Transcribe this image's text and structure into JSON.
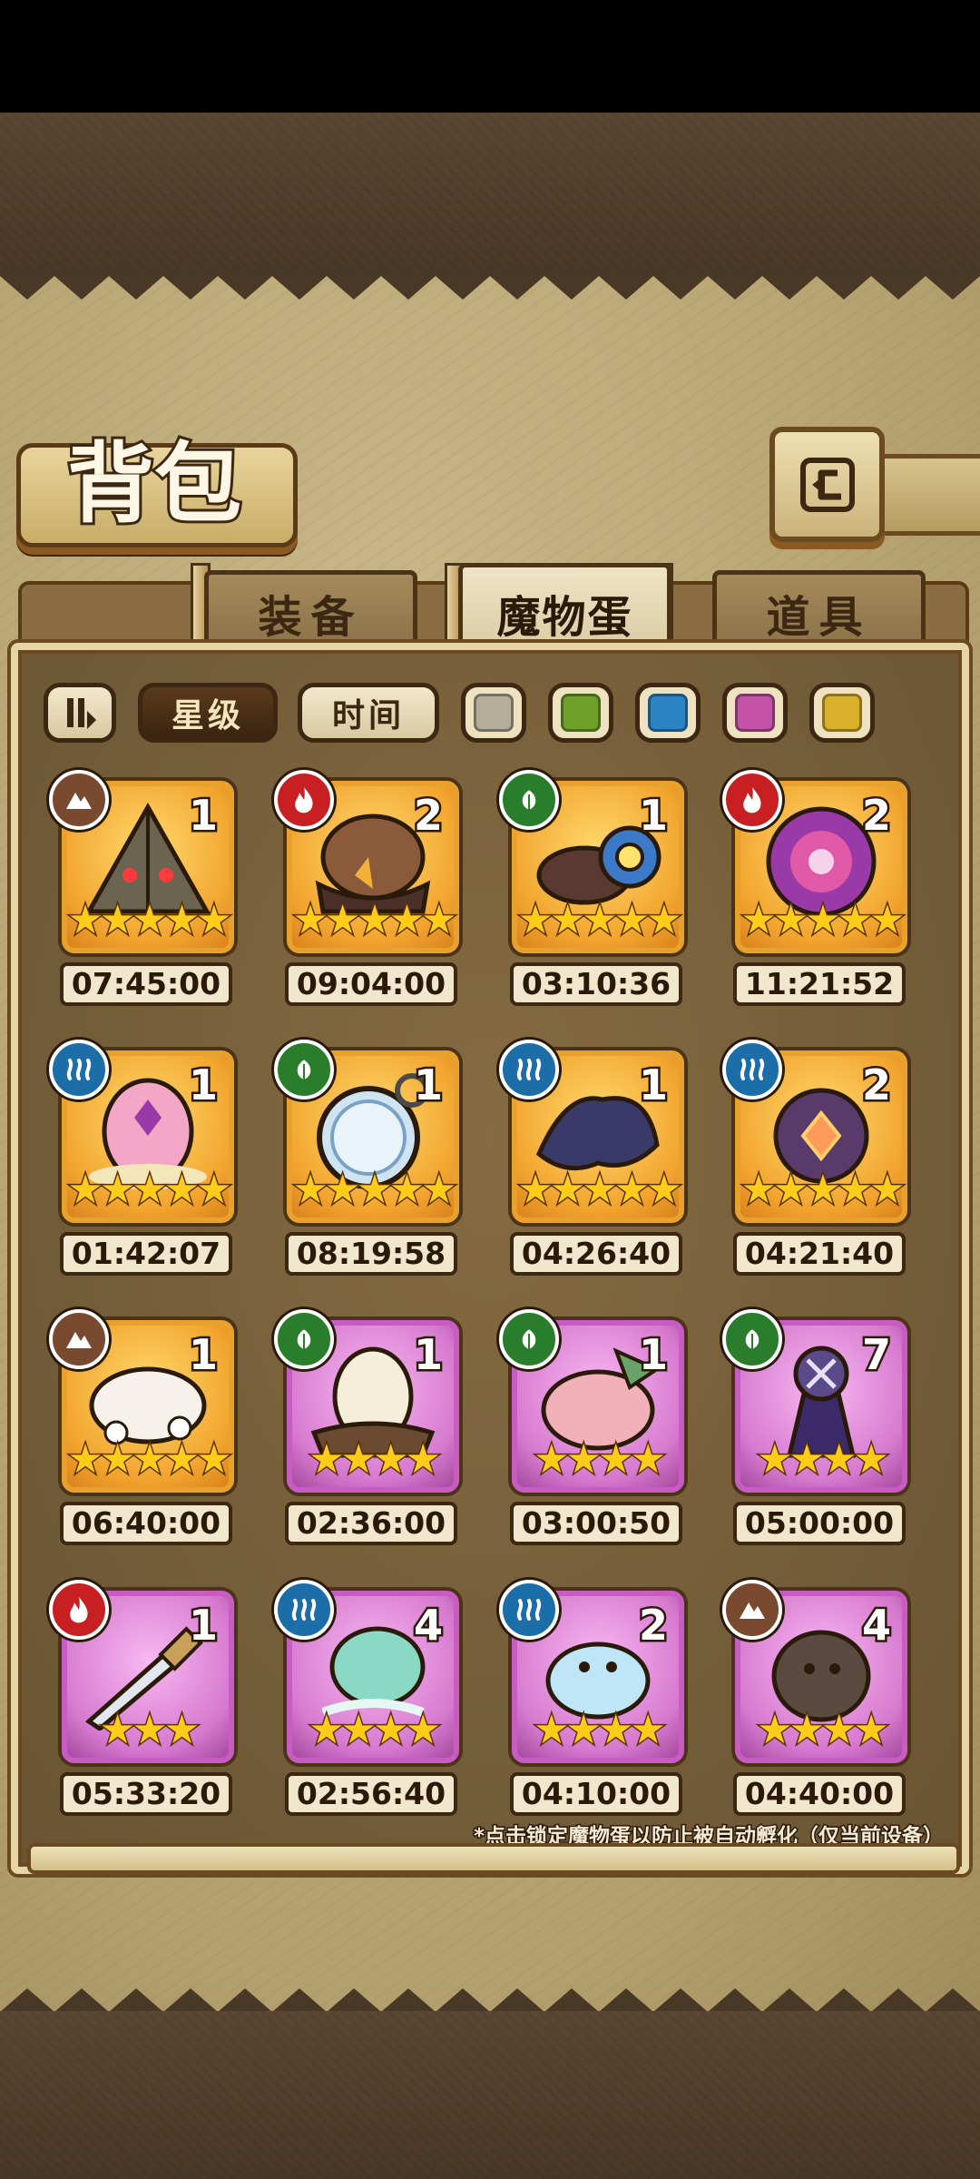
{
  "header": {
    "title": "背包",
    "back_icon": "back-arrow-icon"
  },
  "tabs": [
    {
      "label": "装备",
      "active": false
    },
    {
      "label": "魔物蛋",
      "active": true
    },
    {
      "label": "道具",
      "active": false
    }
  ],
  "filters": {
    "sort_icon": "sort-toggle-icon",
    "star_label": "星级",
    "time_label": "时间",
    "colors": [
      "#b4ad9a",
      "#6fa12a",
      "#2b83c4",
      "#c452a6",
      "#d9b02a"
    ]
  },
  "eggs": [
    {
      "element": "earth",
      "count": "1",
      "stars": "★★★★★",
      "timer": "07:45:00",
      "frame": "gold",
      "art": "pyramid"
    },
    {
      "element": "fire",
      "count": "2",
      "stars": "★★★★★",
      "timer": "09:04:00",
      "frame": "gold",
      "art": "dark-egg"
    },
    {
      "element": "nature",
      "count": "1",
      "stars": "★★★★★",
      "timer": "03:10:36",
      "frame": "gold",
      "art": "eye-creature"
    },
    {
      "element": "fire",
      "count": "2",
      "stars": "★★★★★",
      "timer": "11:21:52",
      "frame": "gold",
      "art": "pink-orb"
    },
    {
      "element": "water",
      "count": "1",
      "stars": "★★★★★",
      "timer": "01:42:07",
      "frame": "gold",
      "art": "pink-gem-egg"
    },
    {
      "element": "nature",
      "count": "1",
      "stars": "★★★★★",
      "timer": "08:19:58",
      "frame": "gold",
      "art": "pocket-watch"
    },
    {
      "element": "water",
      "count": "1",
      "stars": "★★★★★",
      "timer": "04:26:40",
      "frame": "gold",
      "art": "feather-cloak"
    },
    {
      "element": "water",
      "count": "2",
      "stars": "★★★★★",
      "timer": "04:21:40",
      "frame": "gold",
      "art": "spider-egg"
    },
    {
      "element": "earth",
      "count": "1",
      "stars": "★★★★★",
      "timer": "06:40:00",
      "frame": "gold",
      "art": "cloud-flowers"
    },
    {
      "element": "nature",
      "count": "1",
      "stars": "★★★★",
      "timer": "02:36:00",
      "frame": "purple",
      "art": "nest-egg"
    },
    {
      "element": "nature",
      "count": "1",
      "stars": "★★★★",
      "timer": "03:00:50",
      "frame": "purple",
      "art": "pink-blob"
    },
    {
      "element": "nature",
      "count": "7",
      "stars": "★★★★",
      "timer": "05:00:00",
      "frame": "purple",
      "art": "dark-mage"
    },
    {
      "element": "fire",
      "count": "1",
      "stars": "★★★",
      "timer": "05:33:20",
      "frame": "purple",
      "art": "dagger"
    },
    {
      "element": "water",
      "count": "4",
      "stars": "★★★★",
      "timer": "02:56:40",
      "frame": "purple",
      "art": "jelly-creature"
    },
    {
      "element": "water",
      "count": "2",
      "stars": "★★★★",
      "timer": "04:10:00",
      "frame": "purple",
      "art": "water-slime"
    },
    {
      "element": "earth",
      "count": "4",
      "stars": "★★★★",
      "timer": "04:40:00",
      "frame": "purple",
      "art": "mud-sprout"
    }
  ],
  "footnote": "*点击锁定魔物蛋以防止被自动孵化（仅当前设备）"
}
